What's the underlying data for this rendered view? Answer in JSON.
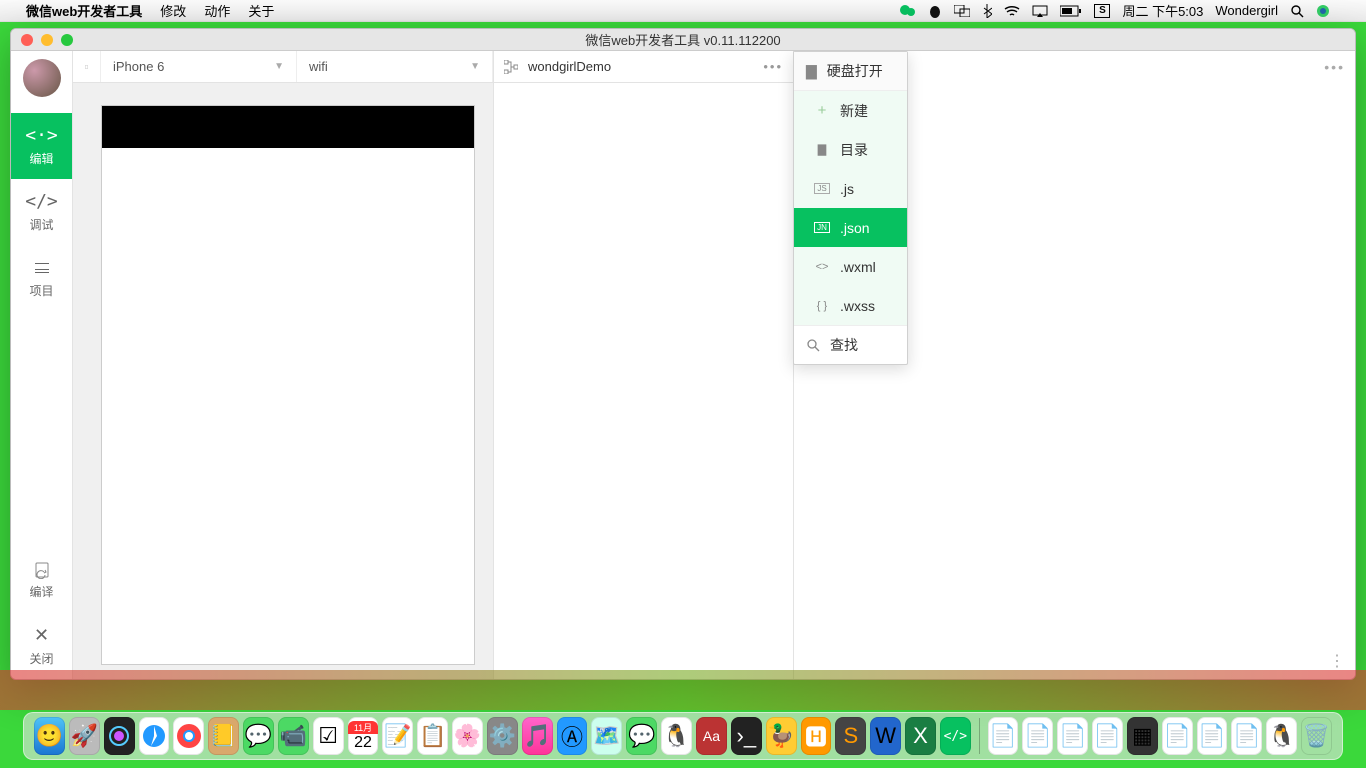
{
  "menubar": {
    "app_name": "微信web开发者工具",
    "items": [
      "修改",
      "动作",
      "关于"
    ],
    "clock": "周二 下午5:03",
    "user": "Wondergirl"
  },
  "window": {
    "title": "微信web开发者工具 v0.11.112200"
  },
  "sidebar": {
    "edit": "编辑",
    "debug": "调试",
    "project": "项目",
    "compile": "编译",
    "close": "关闭"
  },
  "toolbar": {
    "device": "iPhone 6",
    "network": "wifi"
  },
  "filebar": {
    "project_name": "wondgirlDemo"
  },
  "popmenu": {
    "open_disk": "硬盘打开",
    "new": "新建",
    "dir": "目录",
    "js": ".js",
    "json": ".json",
    "wxml": ".wxml",
    "wxss": ".wxss",
    "find": "查找"
  },
  "dock": {
    "cal_day": "22"
  }
}
